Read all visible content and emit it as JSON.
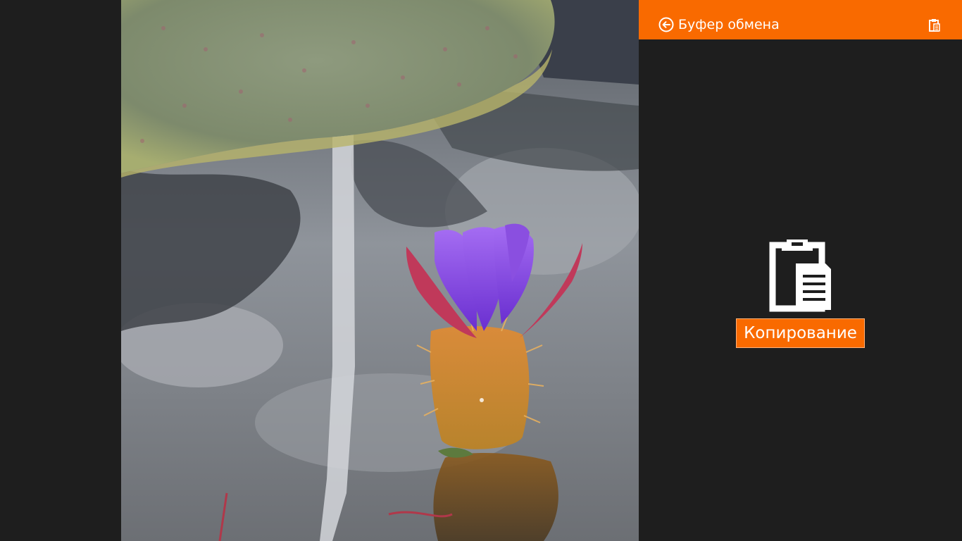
{
  "photo": {
    "subject": "water-lily-photo"
  },
  "flyout": {
    "title": "Буфер обмена",
    "back_icon": "back-arrow-icon",
    "header_icon": "clipboard-icon",
    "main_icon": "clipboard-icon",
    "copy_label": "Копирование"
  },
  "colors": {
    "accent": "#f96a00",
    "background": "#1e1e1e",
    "text": "#ffffff"
  }
}
